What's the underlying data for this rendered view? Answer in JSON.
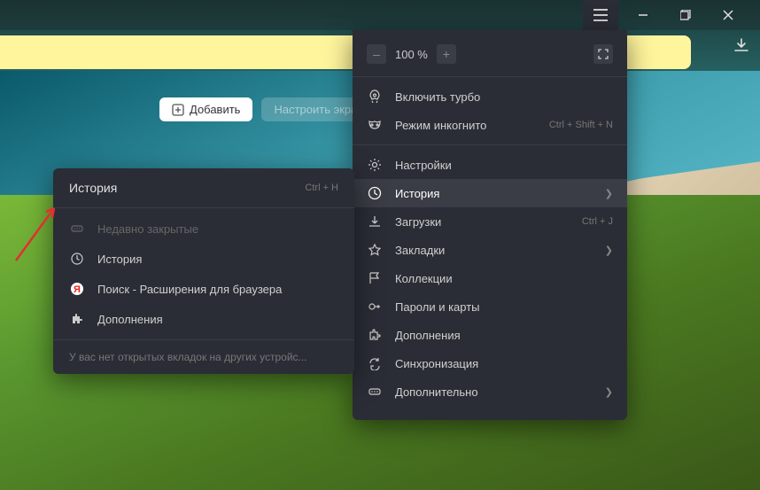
{
  "zoom": {
    "minus": "–",
    "value": "100 %",
    "plus": "+"
  },
  "buttons": {
    "add": "Добавить",
    "customize": "Настроить экра"
  },
  "main_menu": {
    "turbo": "Включить турбо",
    "incognito": {
      "label": "Режим инкогнито",
      "shortcut": "Ctrl + Shift + N"
    },
    "settings": "Настройки",
    "history": "История",
    "downloads": {
      "label": "Загрузки",
      "shortcut": "Ctrl + J"
    },
    "bookmarks": "Закладки",
    "collections": "Коллекции",
    "passwords": "Пароли и карты",
    "addons": "Дополнения",
    "sync": "Синхронизация",
    "more": "Дополнительно"
  },
  "submenu": {
    "title": "История",
    "shortcut": "Ctrl + H",
    "recently_closed": "Недавно закрытые",
    "history": "История",
    "search": "Поиск - Расширения для браузера",
    "addons": "Дополнения",
    "footer": "У вас нет открытых вкладок на других устройс..."
  }
}
